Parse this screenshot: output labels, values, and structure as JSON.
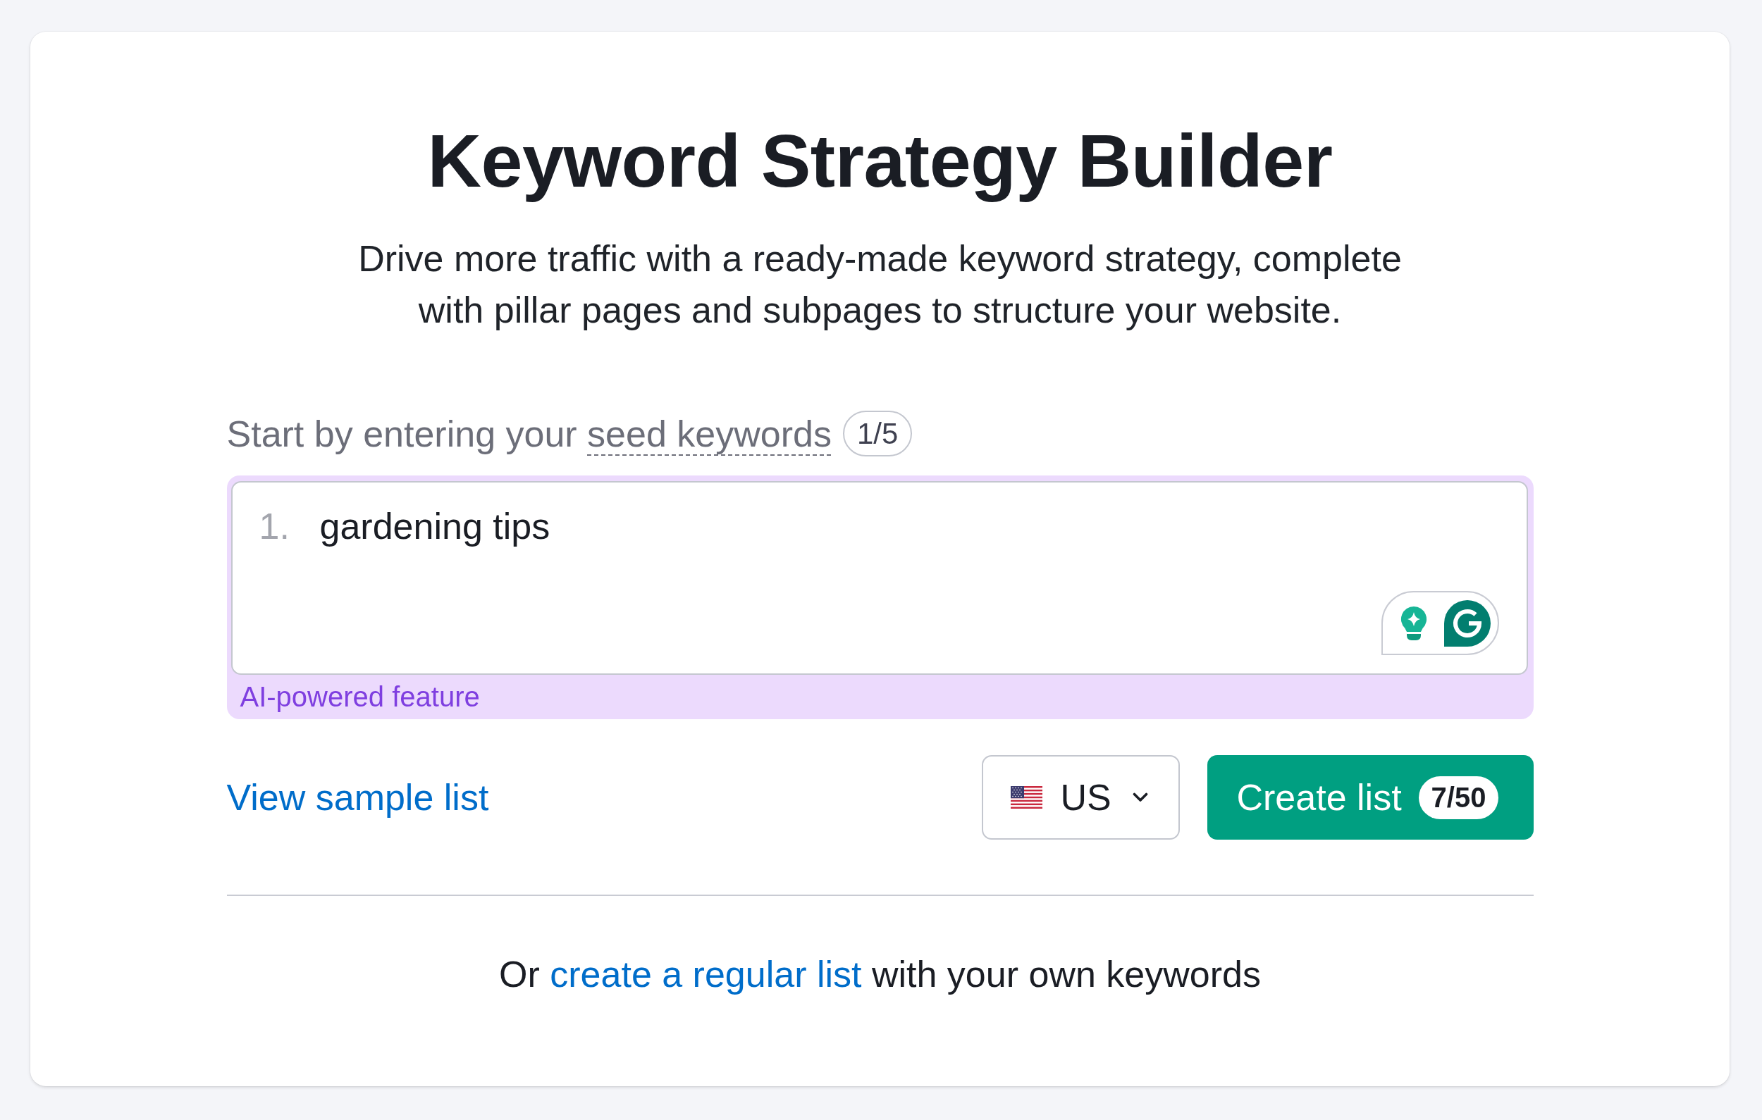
{
  "card": {
    "title": "Keyword Strategy Builder",
    "subtitle": "Drive more traffic with a ready-made keyword strategy, complete with pillar pages and subpages to structure your website.",
    "seed_label": {
      "text": "Start by entering your",
      "term": "seed keywords",
      "count": "1/5"
    },
    "keywords_field": {
      "lines": [
        {
          "number": "1.",
          "text": "gardening tips"
        }
      ],
      "note": "AI-powered feature"
    },
    "sample_link": "View sample list",
    "country_select": {
      "value": "US"
    },
    "create_button": {
      "label": "Create list",
      "badge": "7/50"
    },
    "footer": {
      "text_before": "Or",
      "link": "create a regular list",
      "text_after": "with your own keywords"
    }
  }
}
